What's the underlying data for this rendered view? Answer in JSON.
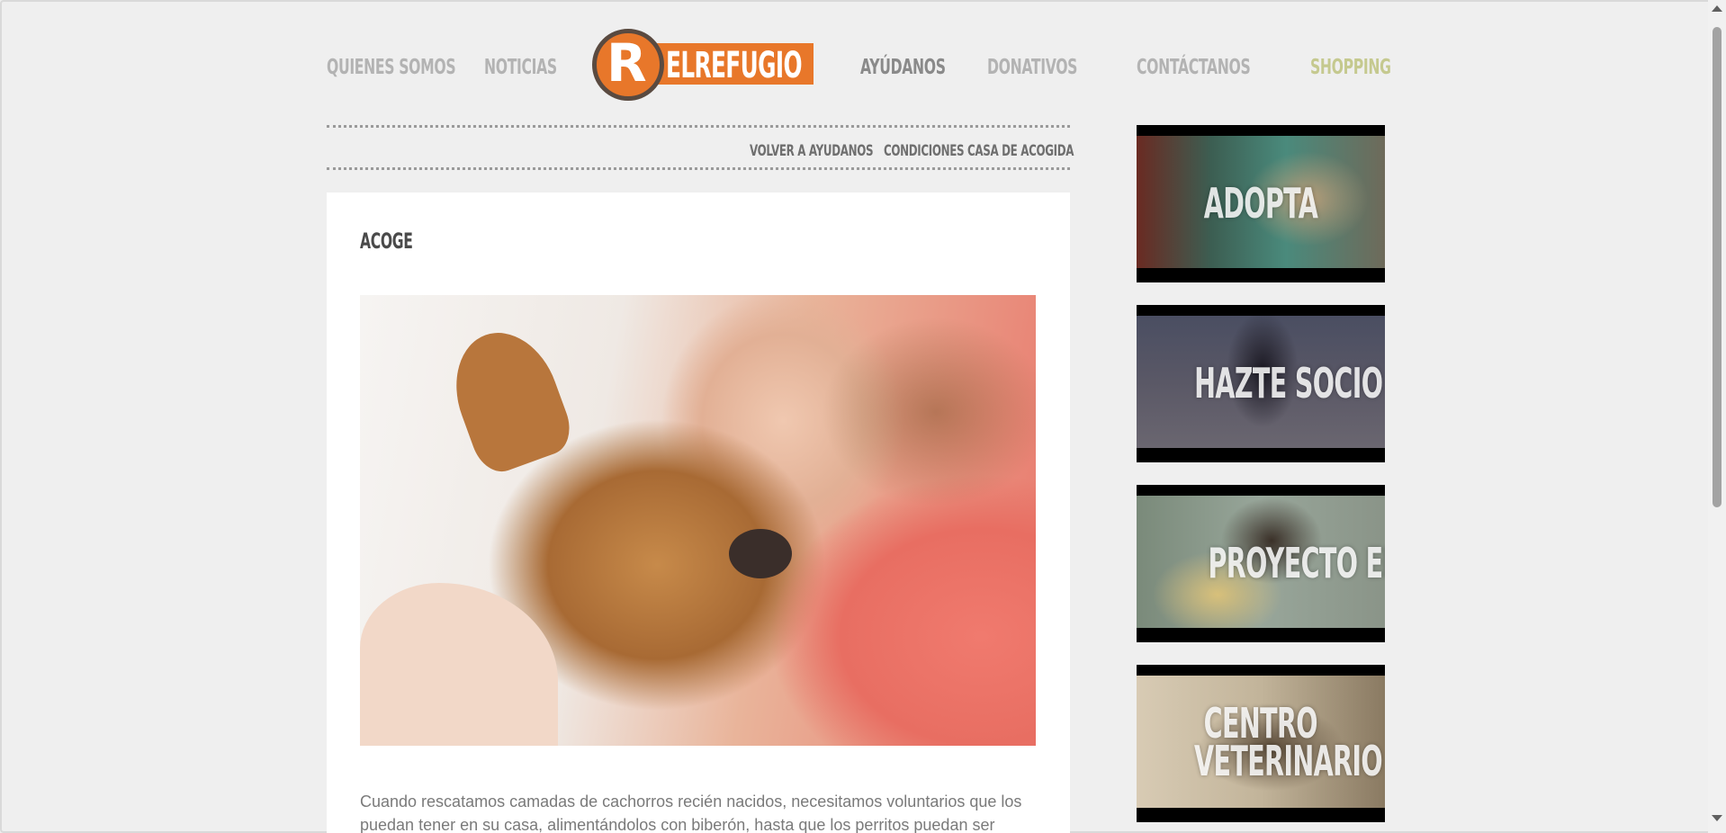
{
  "nav": {
    "quienes": "QUIENES SOMOS",
    "noticias": "NOTICIAS",
    "ayudanos": "AYÚDANOS",
    "donativos": "DONATIVOS",
    "contactanos": "CONTÁCTANOS",
    "shopping": "SHOPPING"
  },
  "logo": {
    "letter": "R",
    "text": "ELREFUGIO"
  },
  "subnav": {
    "volver": "VOLVER A AYUDANOS",
    "condiciones": "CONDICIONES CASA DE ACOGIDA"
  },
  "article": {
    "title": "ACOGE",
    "paragraph": "Cuando rescatamos camadas de cachorros recién nacidos, necesitamos voluntarios que los puedan tener en su casa, alimentándolos con biberón, hasta que los perritos puedan ser"
  },
  "tiles": {
    "adopta": "ADOPTA",
    "hazte_socio": "HAZTE SOCIO",
    "proyecto_eden": "PROYECTO EDÉN",
    "centro_line1": "CENTRO",
    "centro_line2": "VETERINARIO"
  },
  "colors": {
    "brand_orange": "#e8772a",
    "shopping_green": "#c5c98f",
    "nav_gray": "#b3b3b3"
  }
}
